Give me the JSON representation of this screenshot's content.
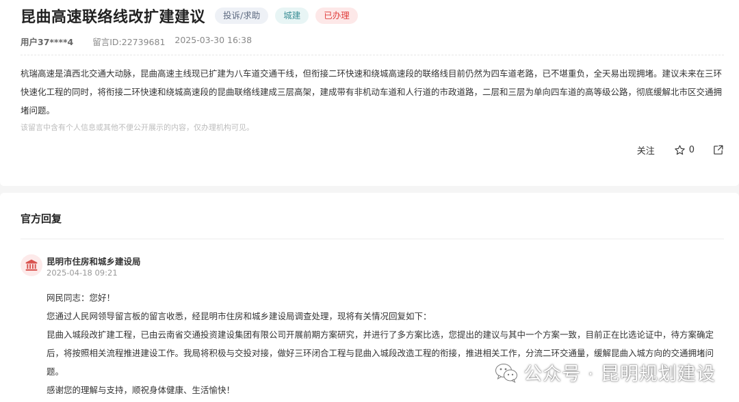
{
  "message": {
    "title": "昆曲高速联络线改扩建建议",
    "tags": {
      "type": "投诉/求助",
      "category": "城建",
      "status": "已办理"
    },
    "user": "用户37****4",
    "message_id": "留言ID:22739681",
    "datetime": "2025-03-30 16:38",
    "content": "杭瑞高速是滇西北交通大动脉，昆曲高速主线现已扩建为八车道交通干线，但衔接二环快速和绕城高速段的联络线目前仍然为四车道老路，已不堪重负，全天易出现拥堵。建议未来在三环快速化工程的同时，将衔接二环快速和绕城高速段的昆曲联络线建成三层高架，建成带有非机动车道和人行道的市政道路，二层和三层为单向四车道的高等级公路，彻底缓解北市区交通拥堵问题。",
    "privacy_notice": "该留言中含有个人信息或其他不便公开展示的内容，仅办理机构可见。",
    "actions": {
      "follow": "关注",
      "like_count": "0"
    }
  },
  "reply": {
    "section_title": "官方回复",
    "org_name": "昆明市住房和城乡建设局",
    "datetime": "2025-04-18 09:21",
    "paragraphs": [
      "网民同志：您好！",
      "您通过人民网领导留言板的留言收悉，经昆明市住房和城乡建设局调查处理，现将有关情况回复如下：",
      "昆曲入城段改扩建工程，已由云南省交通投资建设集团有限公司开展前期方案研究，并进行了多方案比选，您提出的建议与其中一个方案一致，目前正在比选论证中，待方案确定后，将按照相关流程推进建设工作。我局将积极与交投对接，做好三环闭合工程与昆曲入城段改造工程的衔接，推进相关工作，分流二环交通量，缓解昆曲入城方向的交通拥堵问题。",
      "感谢您的理解与支持，顺祝身体健康、生活愉快！"
    ]
  },
  "watermark": {
    "text": "公众号 · 昆明规划建设",
    "icon": "wechat-icon"
  },
  "colors": {
    "status_red": "#e0403e",
    "category_teal": "#3c8f96",
    "org_icon_red": "#d9534f"
  }
}
